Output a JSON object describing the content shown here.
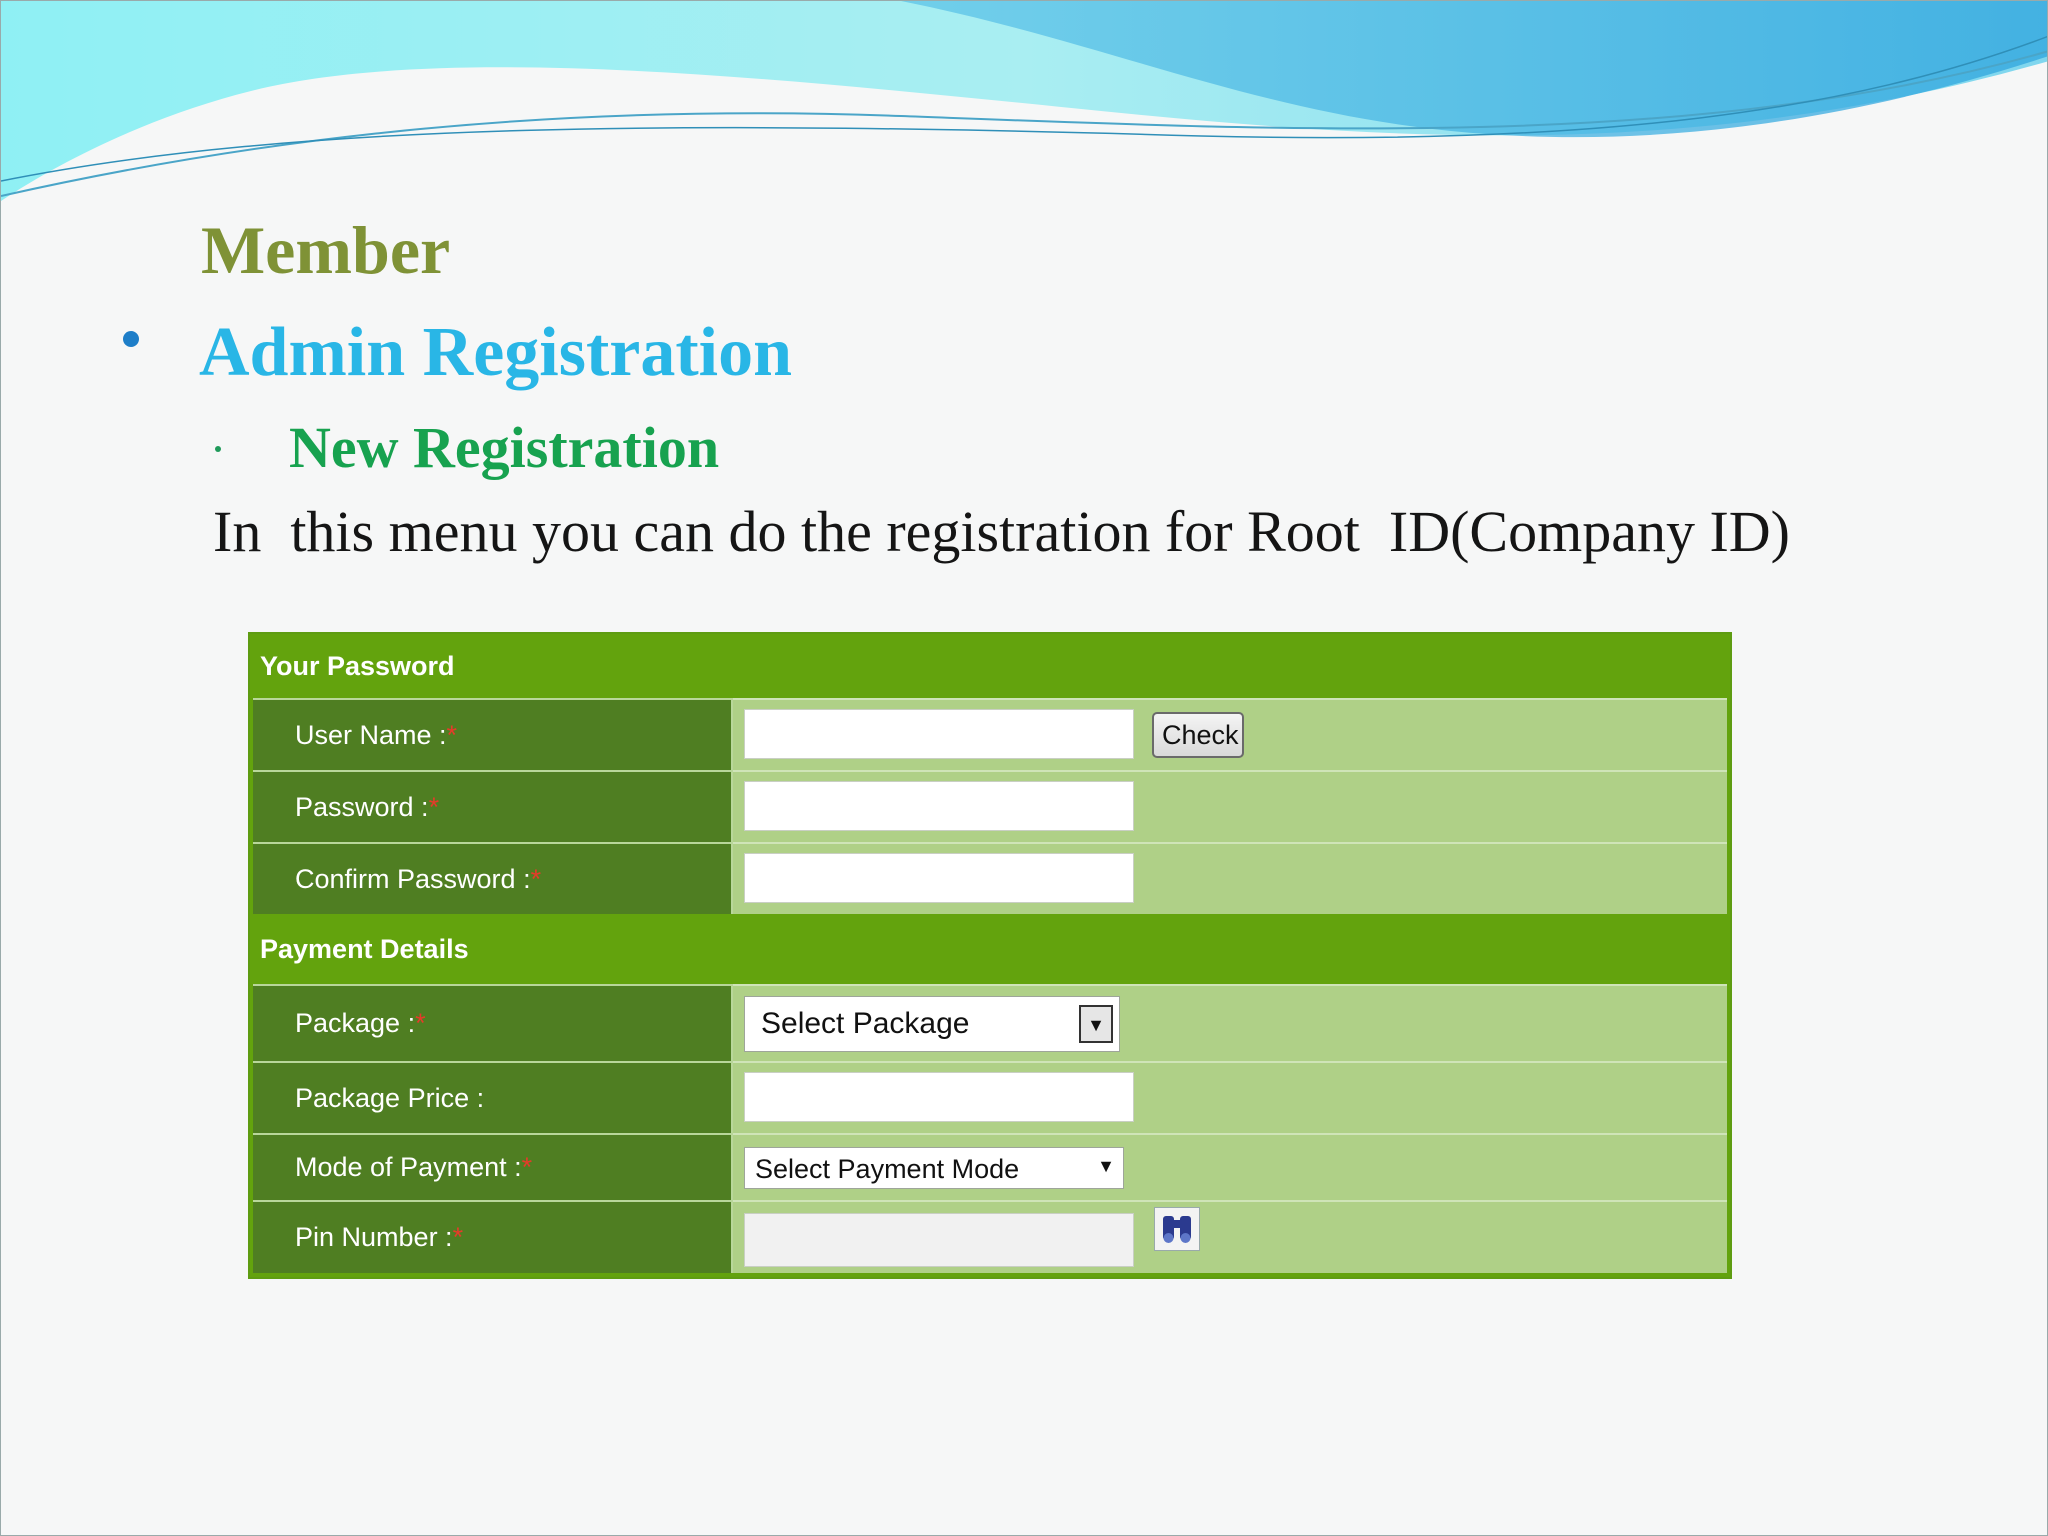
{
  "slide": {
    "heading": "Member",
    "section": "Admin Registration",
    "subsection": "New Registration",
    "description": "In  this menu you can do the registration for Root  ID(Company ID)"
  },
  "form": {
    "password_section": {
      "title": "Your Password",
      "user_name_label": "User Name : ",
      "password_label": "Password :",
      "confirm_password_label": "Confirm Password :",
      "check_button": "Check"
    },
    "payment_section": {
      "title": "Payment Details",
      "package_label": "Package :",
      "package_select": "Select Package",
      "package_price_label": "Package Price :",
      "mode_of_payment_label": "Mode of Payment :",
      "payment_mode_select": "Select Payment Mode",
      "pin_number_label": "Pin Number :"
    },
    "required_marker": "*"
  },
  "colors": {
    "form_header": "#63a30d",
    "label_cell": "#4f7e22",
    "value_cell": "#afd087",
    "required": "#e53b2a",
    "title_member": "#7f9236",
    "title_admin": "#29b6e6",
    "subtitle": "#17a24f"
  },
  "icons": {
    "bullet": "bullet-dot-icon",
    "dropdown": "chevron-down-icon",
    "search": "binoculars-icon"
  }
}
